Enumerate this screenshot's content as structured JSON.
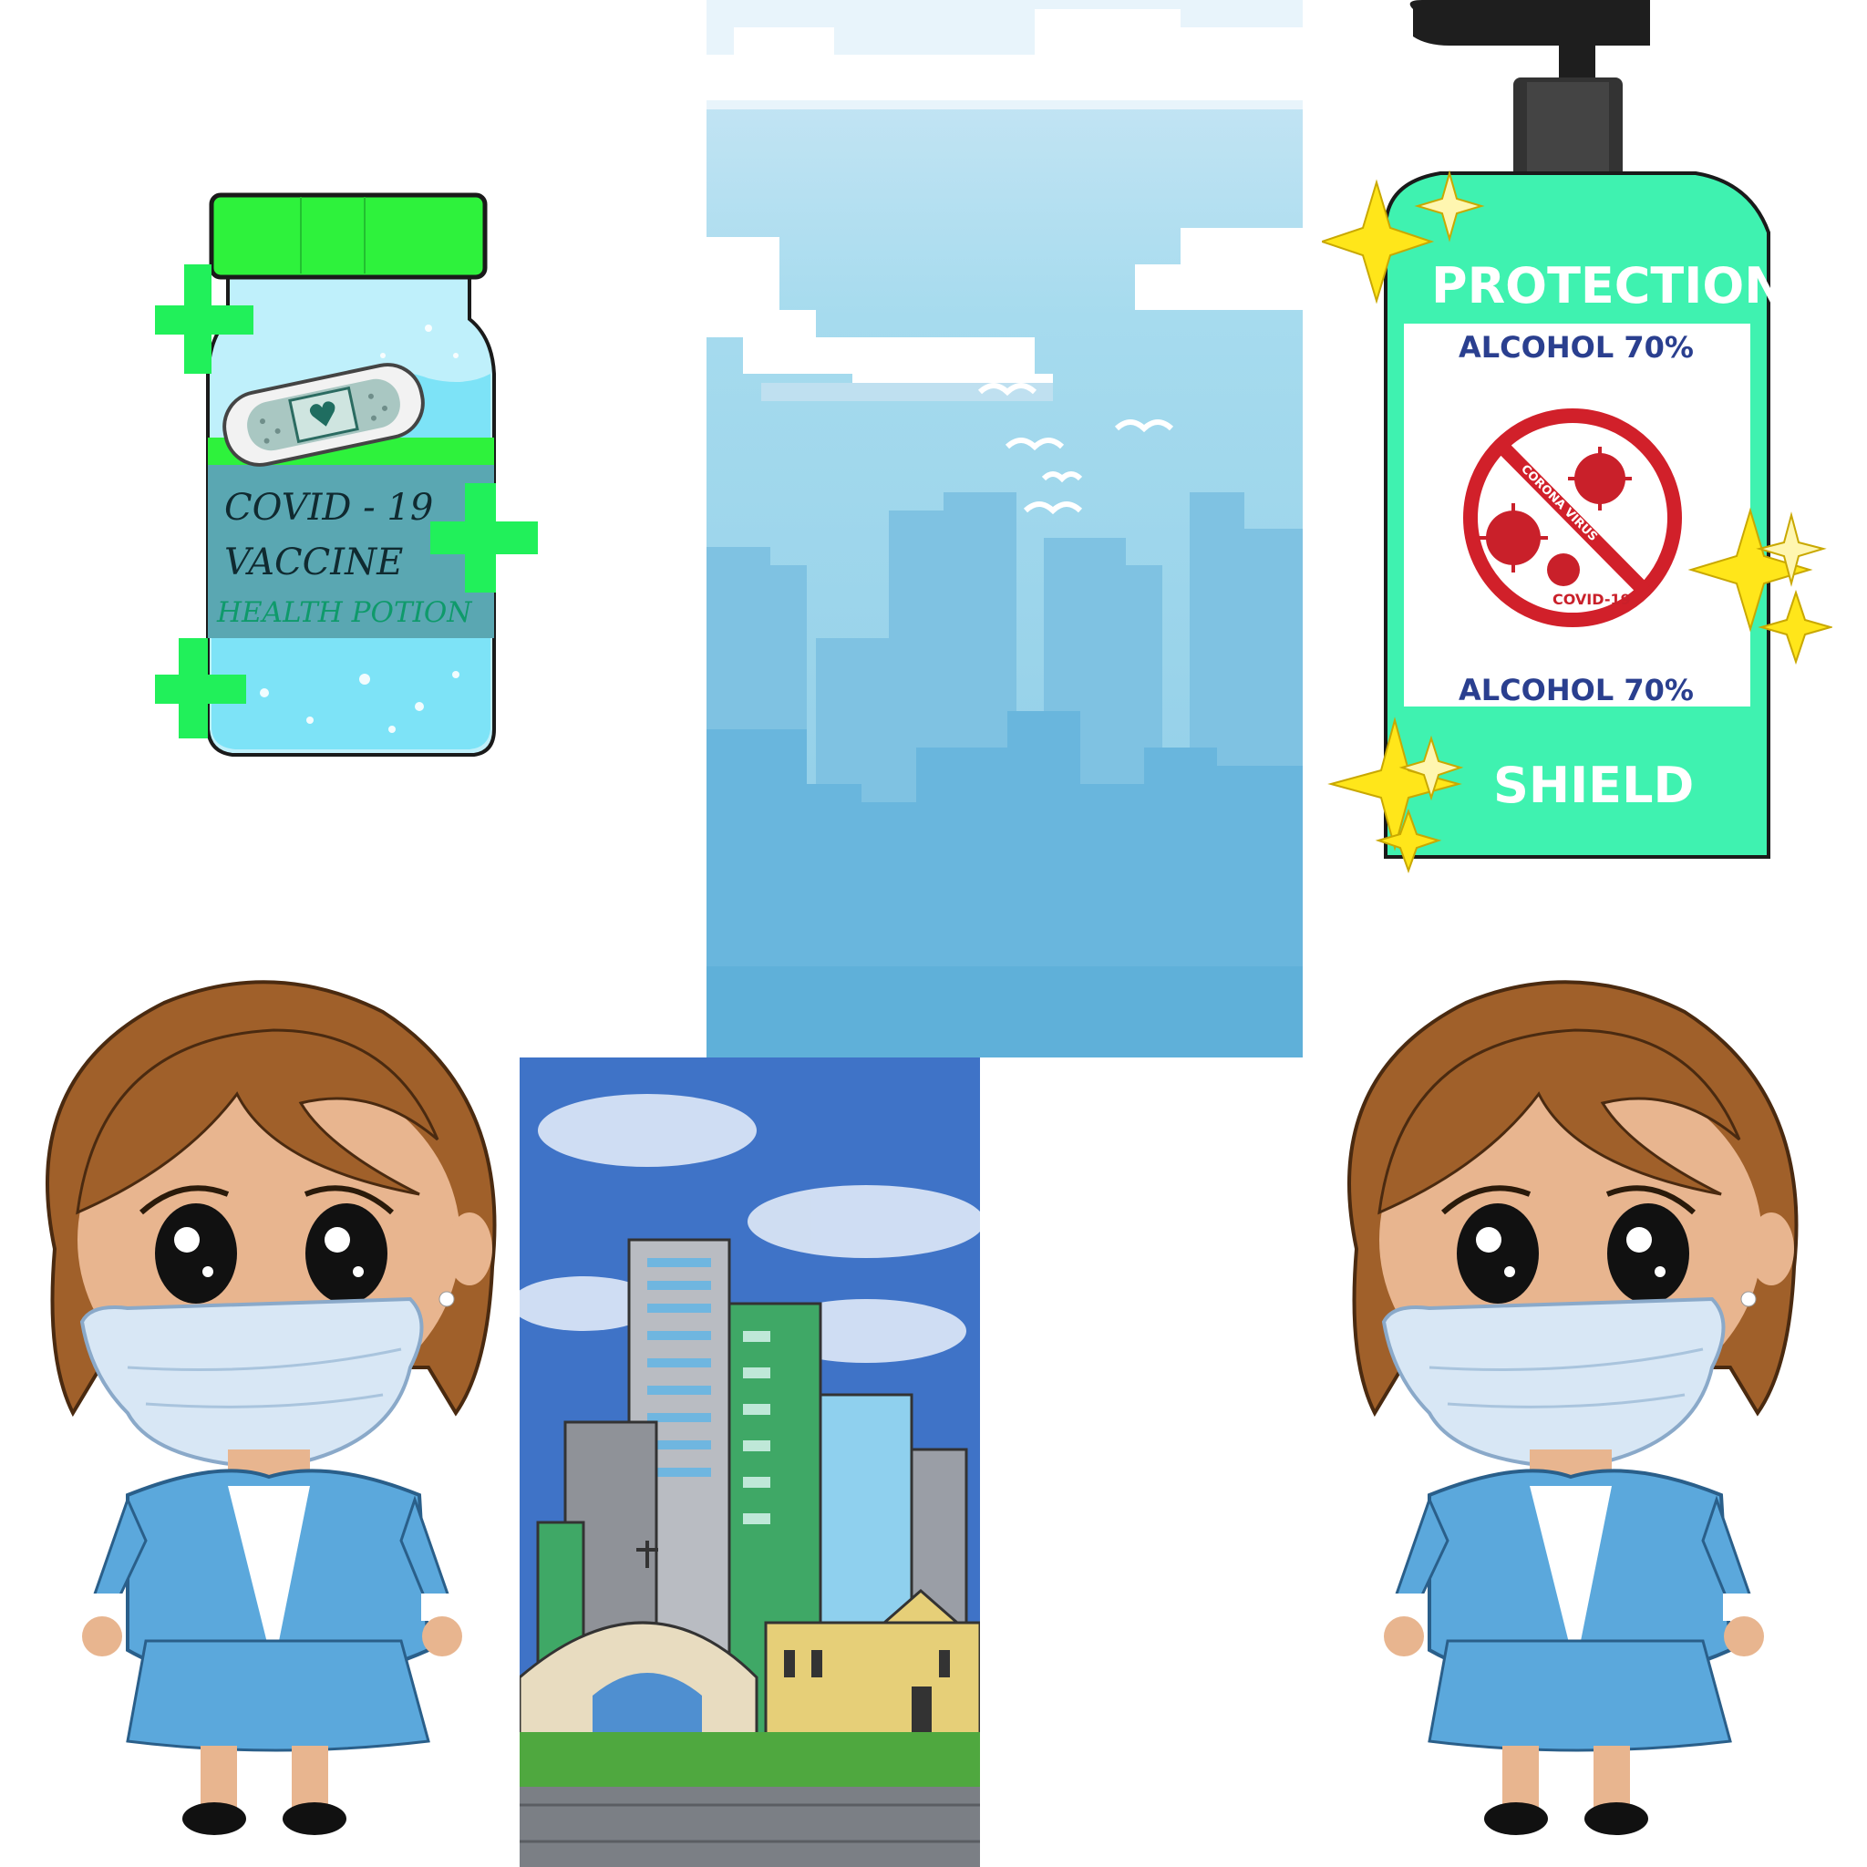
{
  "vaccine": {
    "line1": "COVID - 19",
    "line2": "VACCINE",
    "line3": "HEALTH POTION"
  },
  "sanitizer": {
    "title": "PROTECTION",
    "alcohol_top": "ALCOHOL 70%",
    "alcohol_bottom": "ALCOHOL 70%",
    "badge_arc": "CORONA VIRUS",
    "badge_bottom": "COVID-19",
    "footer": "SHIELD"
  },
  "colors": {
    "cap_green": "#2ef23c",
    "plus_green": "#21f05a",
    "vial_glass": "#bff0fb",
    "vial_liquid": "#7de3f7",
    "vial_label": "#5aa7b2",
    "sky_top": "#cfe8f6",
    "sky_mid": "#96d3e8",
    "skyline": "#78bfe0",
    "city_sky": "#3f73c7",
    "sanitizer_body": "#3ff2b0",
    "sparkle": "#ffe61a",
    "jacket": "#5ba8dc",
    "hair": "#a0602a",
    "mask": "#d8e7f5"
  }
}
